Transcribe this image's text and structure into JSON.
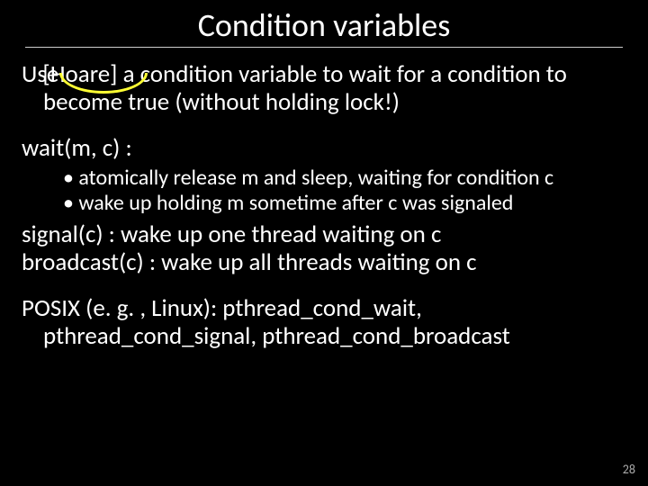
{
  "title": "Condition variables",
  "intro_pre": "Use ",
  "intro_hoare": "[Hoare]",
  "intro_post": " a condition variable to wait for a condition to become true (without holding lock!)",
  "wait_heading": "wait(m, c) :",
  "wait_bullets": [
    "atomically release m and sleep, waiting for condition c",
    "wake up holding m sometime after c was signaled"
  ],
  "signal_line": "signal(c) : wake up one thread waiting on  c",
  "broadcast_line": "broadcast(c) : wake up all threads waiting on  c",
  "posix_line": "POSIX (e. g. , Linux): pthread_cond_wait, pthread_cond_signal, pthread_cond_broadcast",
  "page_number": "28"
}
